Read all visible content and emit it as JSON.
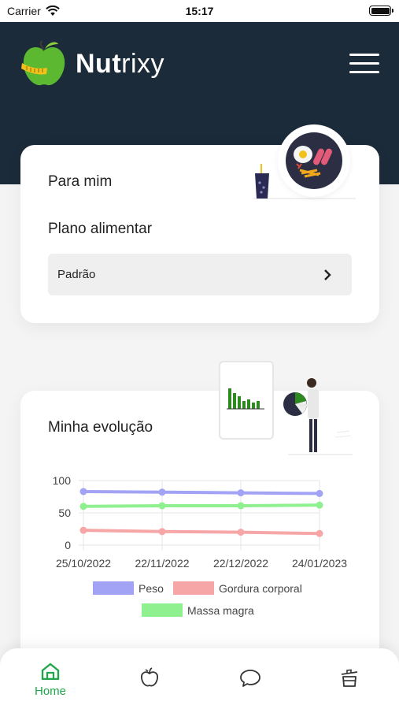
{
  "status_bar": {
    "carrier": "Carrier",
    "time": "15:17"
  },
  "header": {
    "brand_bold": "Nut",
    "brand_light": "rixy"
  },
  "card_plan": {
    "for_me_label": "Para mim",
    "plan_label": "Plano alimentar",
    "plan_value": "Padrão"
  },
  "card_evolution": {
    "title": "Minha evolução"
  },
  "chart_data": {
    "type": "line",
    "x": [
      "25/10/2022",
      "22/11/2022",
      "22/12/2022",
      "24/01/2023"
    ],
    "ylim": [
      0,
      100
    ],
    "yticks": [
      "100",
      "50",
      "0"
    ],
    "grid": true,
    "legend_position": "bottom",
    "series": [
      {
        "name": "Peso",
        "values": [
          83,
          82,
          81,
          80
        ],
        "color": "#a3a3f5"
      },
      {
        "name": "Gordura corporal",
        "values": [
          23,
          21,
          20,
          18
        ],
        "color": "#f6a6a6"
      },
      {
        "name": "Massa magra",
        "values": [
          60,
          61,
          61,
          62
        ],
        "color": "#8ff08f"
      }
    ]
  },
  "bottom_nav": {
    "items": [
      {
        "label": "Home",
        "icon": "home-icon",
        "active": true
      },
      {
        "label": "",
        "icon": "apple-icon"
      },
      {
        "label": "",
        "icon": "chat-bubble-icon"
      },
      {
        "label": "",
        "icon": "pot-icon"
      }
    ],
    "active_color": "#1fa64a"
  },
  "colors": {
    "header_bg": "#1c2b3a",
    "accent_green": "#1fa64a"
  }
}
